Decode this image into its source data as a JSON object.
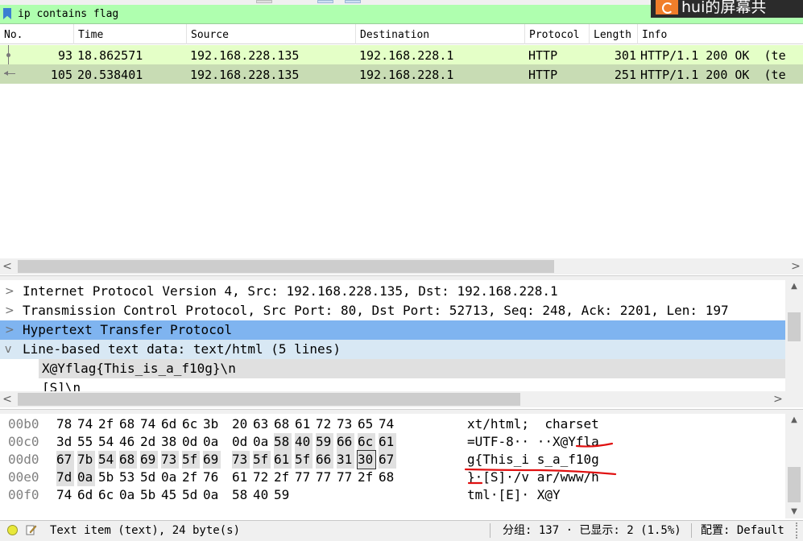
{
  "filter": {
    "value": "ip contains flag"
  },
  "overlay": {
    "text": "hui的屏幕共"
  },
  "packet_list": {
    "columns": [
      "No.",
      "Time",
      "Source",
      "Destination",
      "Protocol",
      "Length",
      "Info"
    ],
    "rows": [
      {
        "no": "93",
        "time": "18.862571",
        "source": "192.168.228.135",
        "destination": "192.168.228.1",
        "protocol": "HTTP",
        "length": "301",
        "info": "HTTP/1.1 200 OK  (te"
      },
      {
        "no": "105",
        "time": "20.538401",
        "source": "192.168.228.135",
        "destination": "192.168.228.1",
        "protocol": "HTTP",
        "length": "251",
        "info": "HTTP/1.1 200 OK  (te"
      }
    ]
  },
  "details": {
    "rows": [
      {
        "chevron": ">",
        "text": "Internet Protocol Version 4, Src: 192.168.228.135, Dst: 192.168.228.1"
      },
      {
        "chevron": ">",
        "text": "Transmission Control Protocol, Src Port: 80, Dst Port: 52713, Seq: 248, Ack: 2201, Len: 197"
      },
      {
        "chevron": ">",
        "text": "Hypertext Transfer Protocol"
      },
      {
        "chevron": "v",
        "text": "Line-based text data: text/html (5 lines)"
      },
      {
        "chevron": "",
        "text": "X@Yflag{This_is_a_f10g}\\n"
      },
      {
        "chevron": "",
        "text": "[S]\\n"
      }
    ]
  },
  "bytes": {
    "rows": [
      {
        "offset": "00b0",
        "hex": [
          "78",
          "74",
          "2f",
          "68",
          "74",
          "6d",
          "6c",
          "3b",
          "20",
          "63",
          "68",
          "61",
          "72",
          "73",
          "65",
          "74"
        ],
        "ascii": "xt/html;  charset"
      },
      {
        "offset": "00c0",
        "hex": [
          "3d",
          "55",
          "54",
          "46",
          "2d",
          "38",
          "0d",
          "0a",
          "0d",
          "0a",
          "58",
          "40",
          "59",
          "66",
          "6c",
          "61"
        ],
        "ascii": "=UTF-8·· ··X@Yfla"
      },
      {
        "offset": "00d0",
        "hex": [
          "67",
          "7b",
          "54",
          "68",
          "69",
          "73",
          "5f",
          "69",
          "73",
          "5f",
          "61",
          "5f",
          "66",
          "31",
          "30",
          "67"
        ],
        "ascii": "g{This_i s_a_f10g"
      },
      {
        "offset": "00e0",
        "hex": [
          "7d",
          "0a",
          "5b",
          "53",
          "5d",
          "0a",
          "2f",
          "76",
          "61",
          "72",
          "2f",
          "77",
          "77",
          "77",
          "2f",
          "68"
        ],
        "ascii": "}·[S]·/v ar/www/h"
      },
      {
        "offset": "00f0",
        "hex": [
          "74",
          "6d",
          "6c",
          "0a",
          "5b",
          "45",
          "5d",
          "0a",
          "58",
          "40",
          "59"
        ],
        "ascii": "tml·[E]· X@Y"
      }
    ]
  },
  "status": {
    "item": "Text item (text), 24 byte(s)",
    "packets": "分组: 137 · 已显示: 2 (1.5%)",
    "profile": "配置: Default"
  },
  "colors": {
    "filter_ok": "#afffaf",
    "row_93": "#e4ffc7",
    "row_105": "#c8dcb4",
    "selected_detail": "#7fb4f0",
    "highlight_detail": "#d8e8f4",
    "field_line": "#e0e0e0",
    "annotation": "#e01010"
  }
}
